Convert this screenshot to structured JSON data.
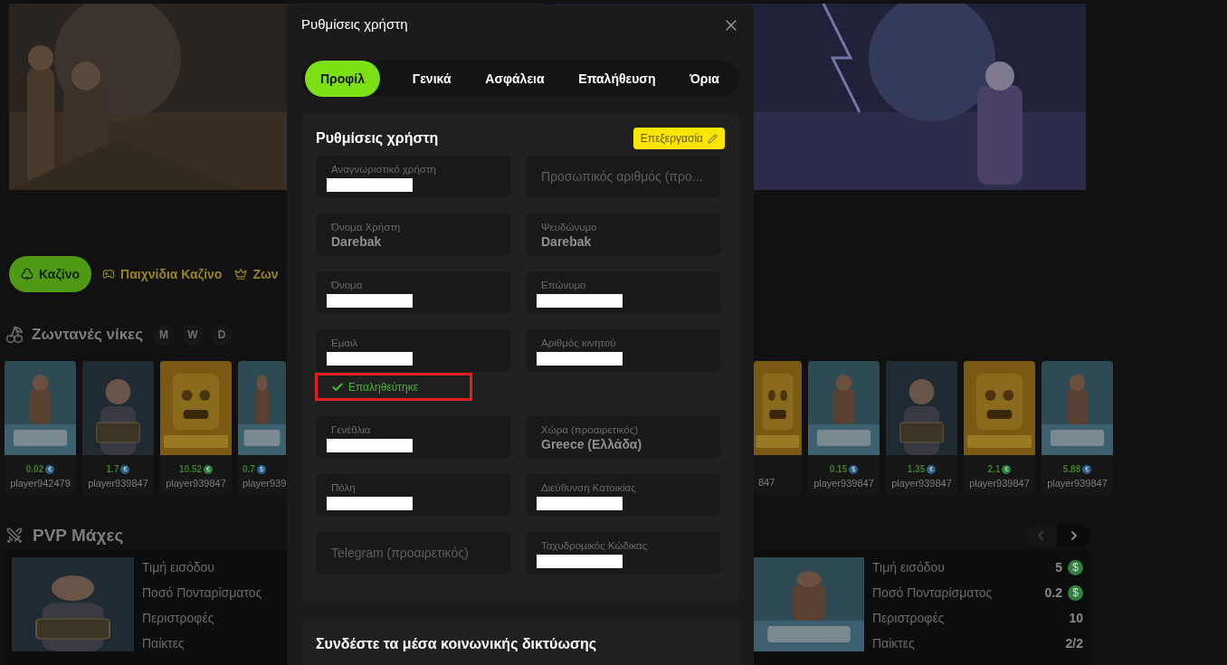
{
  "categories": [
    {
      "label": "Καζίνο",
      "selected": true
    },
    {
      "label": "Παιχνίδια Καζίνο",
      "selected": false
    },
    {
      "label": "Ζων",
      "selected": false
    }
  ],
  "live_wins": {
    "title": "Ζωντανές νίκες",
    "filters": [
      {
        "label": "M",
        "selected": false
      },
      {
        "label": "W",
        "selected": false
      },
      {
        "label": "D",
        "selected": false
      }
    ],
    "left_cards": [
      {
        "amount": "0.02",
        "coin": "€",
        "player": "player942479",
        "cut": false
      },
      {
        "amount": "1.7",
        "coin": "€",
        "player": "player939847",
        "cut": false
      },
      {
        "amount": "10.52",
        "coin": "€",
        "player": "player939847",
        "cut": false
      },
      {
        "amount": "0.7",
        "coin": "$",
        "player": "player939",
        "cut": true
      }
    ],
    "right_cards": [
      {
        "player": "847",
        "cut": true
      },
      {
        "amount": "0.15",
        "coin": "$",
        "player": "player939847",
        "cut": false
      },
      {
        "amount": "1.35",
        "coin": "€",
        "player": "player939847",
        "cut": false
      },
      {
        "amount": "2.1",
        "coin": "€",
        "player": "player939847",
        "cut": false
      },
      {
        "amount": "5.88",
        "coin": "€",
        "player": "player939847",
        "cut": false
      }
    ]
  },
  "pvp": {
    "title": "PVP Μάχες",
    "left_battle": {
      "stats": [
        {
          "label": "Τιμή εισόδου"
        },
        {
          "label": "Ποσό Πονταρίσματος"
        },
        {
          "label": "Περιστροφές"
        },
        {
          "label": "Παίκτες"
        }
      ]
    },
    "right_battle": {
      "stats": [
        {
          "label": "Τιμή εισόδου",
          "value": "5",
          "coin": "$"
        },
        {
          "label": "Ποσό Πονταρίσματος",
          "value": "0.2",
          "coin": "$"
        },
        {
          "label": "Περιστροφές",
          "value": "10"
        },
        {
          "label": "Παίκτες",
          "value": "2/2"
        }
      ]
    }
  },
  "modal": {
    "title": "Ρυθμίσεις χρήστη",
    "tabs": [
      {
        "label": "Προφίλ",
        "selected": true
      },
      {
        "label": "Γενικά",
        "selected": false
      },
      {
        "label": "Ασφάλεια",
        "selected": false
      },
      {
        "label": "Επαλήθευση",
        "selected": false
      },
      {
        "label": "Όρια",
        "selected": false
      }
    ],
    "section": {
      "title": "Ρυθμίσεις χρήστη",
      "edit_button": "Επεξεργασία",
      "rows": [
        [
          {
            "label": "Αναγνωριστικό χρήστη",
            "redacted": true
          },
          {
            "placeholder": "Προσωπικός αριθμός (προ..."
          }
        ],
        [
          {
            "label": "Όνομα Χρήστη",
            "value": "Darebak"
          },
          {
            "label": "Ψευδώνυμο",
            "value": "Darebak"
          }
        ],
        [
          {
            "label": "Όνομα",
            "redacted": true
          },
          {
            "label": "Επώνυμο",
            "redacted": true
          }
        ],
        [
          {
            "label": "Εμαιλ",
            "redacted": true,
            "badge": "Επαληθεύτηκε",
            "highlighted": true
          },
          {
            "label": "Αριθμός κινητού",
            "redacted": true
          }
        ],
        [
          {
            "label": "Γενέθλια",
            "redacted": true
          },
          {
            "label": "Χώρα (προαιρετικός)",
            "value": "Greece (Ελλάδα)"
          }
        ],
        [
          {
            "label": "Πόλη",
            "redacted": true
          },
          {
            "label": "Διεύθυνση Κατοικίας",
            "redacted": true
          }
        ],
        [
          {
            "placeholder": "Telegram (προαιρετικός)"
          },
          {
            "label": "Ταχυδρομικός Κώδικας",
            "redacted": true
          }
        ]
      ]
    },
    "social": {
      "title": "Συνδέστε τα μέσα κοινωνικής δικτύωσης"
    }
  }
}
